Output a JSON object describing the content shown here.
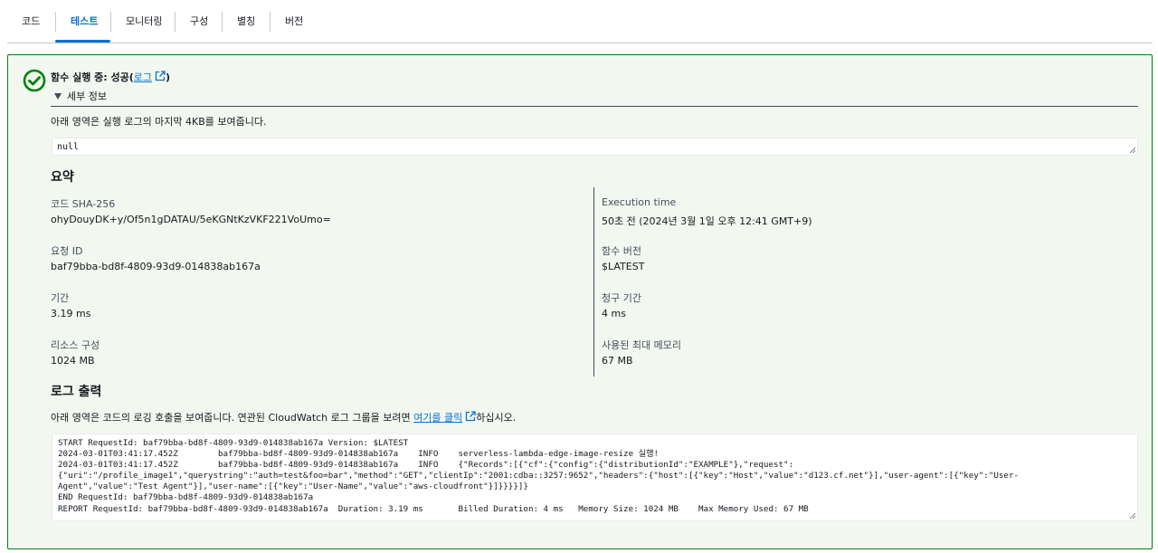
{
  "tabs": [
    {
      "label": "코드"
    },
    {
      "label": "테스트",
      "active": true
    },
    {
      "label": "모니터링"
    },
    {
      "label": "구성"
    },
    {
      "label": "별칭"
    },
    {
      "label": "버전"
    }
  ],
  "status": {
    "prefix": "함수 실행 중: 성공(",
    "log_link": "로그",
    "suffix": ")",
    "state_color": "#037f0c",
    "icon": "check-circle-icon"
  },
  "details": {
    "toggle_label": "세부 정보",
    "result_description": "아래 영역은 실행 로그의 마지막 4KB를 보여줍니다.",
    "result_value": "null"
  },
  "summary": {
    "heading": "요약",
    "left": [
      {
        "label": "코드 SHA-256",
        "value": "ohyDouyDK+y/Of5n1gDATAU/5eKGNtKzVKF221VoUmo="
      },
      {
        "label": "요청 ID",
        "value": "baf79bba-bd8f-4809-93d9-014838ab167a"
      },
      {
        "label": "기간",
        "value": "3.19 ms"
      },
      {
        "label": "리소스 구성",
        "value": "1024 MB"
      }
    ],
    "right": [
      {
        "label": "Execution time",
        "value": "50초 전 (2024년 3월 1일 오후 12:41 GMT+9)"
      },
      {
        "label": "함수 버전",
        "value": "$LATEST"
      },
      {
        "label": "청구 기간",
        "value": "4 ms"
      },
      {
        "label": "사용된 최대 메모리",
        "value": "67 MB"
      }
    ]
  },
  "log_output": {
    "heading": "로그 출력",
    "description_prefix": "아래 영역은 코드의 로깅 호출을 보여줍니다. 연관된 CloudWatch 로그 그룹을 보려면 ",
    "description_link": "여기를 클릭",
    "description_suffix": "하십시오.",
    "lines": [
      "START RequestId: baf79bba-bd8f-4809-93d9-014838ab167a Version: $LATEST",
      "2024-03-01T03:41:17.452Z\tbaf79bba-bd8f-4809-93d9-014838ab167a\tINFO\tserverless-lambda-edge-image-resize 실행!",
      "2024-03-01T03:41:17.452Z\tbaf79bba-bd8f-4809-93d9-014838ab167a\tINFO\t{\"Records\":[{\"cf\":{\"config\":{\"distributionId\":\"EXAMPLE\"},\"request\":",
      "{\"uri\":\"/profile_image1\",\"querystring\":\"auth=test&foo=bar\",\"method\":\"GET\",\"clientIp\":\"2001:cdba::3257:9652\",\"headers\":{\"host\":[{\"key\":\"Host\",\"value\":\"d123.cf.net\"}],\"user-agent\":[{\"key\":\"User-",
      "Agent\",\"value\":\"Test Agent\"}],\"user-name\":[{\"key\":\"User-Name\",\"value\":\"aws-cloudfront\"}]}}}}]}",
      "END RequestId: baf79bba-bd8f-4809-93d9-014838ab167a",
      "REPORT RequestId: baf79bba-bd8f-4809-93d9-014838ab167a\tDuration: 3.19 ms\tBilled Duration: 4 ms\tMemory Size: 1024 MB\tMax Memory Used: 67 MB\t"
    ]
  }
}
